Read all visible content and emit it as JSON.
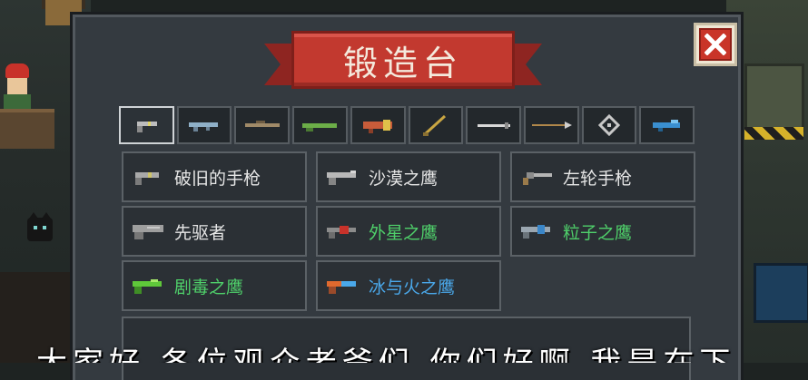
{
  "window": {
    "title": "锻造台",
    "close_icon": "close-x-icon"
  },
  "tabs": [
    {
      "icon": "pistol-icon",
      "active": true
    },
    {
      "icon": "rifle-icon",
      "active": false
    },
    {
      "icon": "sniper-icon",
      "active": false
    },
    {
      "icon": "shotgun-icon",
      "active": false
    },
    {
      "icon": "launcher-icon",
      "active": false
    },
    {
      "icon": "staff-icon",
      "active": false
    },
    {
      "icon": "sword-icon",
      "active": false
    },
    {
      "icon": "spear-icon",
      "active": false
    },
    {
      "icon": "throwable-icon",
      "active": false
    },
    {
      "icon": "special-weapon-icon",
      "active": false
    }
  ],
  "weapons": [
    {
      "name": "破旧的手枪",
      "color": "#e6e6e6",
      "icon": "old-pistol-icon"
    },
    {
      "name": "沙漠之鹰",
      "color": "#e6e6e6",
      "icon": "desert-eagle-icon"
    },
    {
      "name": "左轮手枪",
      "color": "#e6e6e6",
      "icon": "revolver-icon"
    },
    {
      "name": "先驱者",
      "color": "#e6e6e6",
      "icon": "pioneer-icon"
    },
    {
      "name": "外星之鹰",
      "color": "#4fd06a",
      "icon": "alien-eagle-icon"
    },
    {
      "name": "粒子之鹰",
      "color": "#4fd06a",
      "icon": "particle-eagle-icon"
    },
    {
      "name": "剧毒之鹰",
      "color": "#4fd06a",
      "icon": "toxic-eagle-icon"
    },
    {
      "name": "冰与火之鹰",
      "color": "#4aa8ea",
      "icon": "ice-fire-eagle-icon"
    }
  ],
  "subtitle": "大家好 各位观众老爷们 你们好啊 我是在下"
}
